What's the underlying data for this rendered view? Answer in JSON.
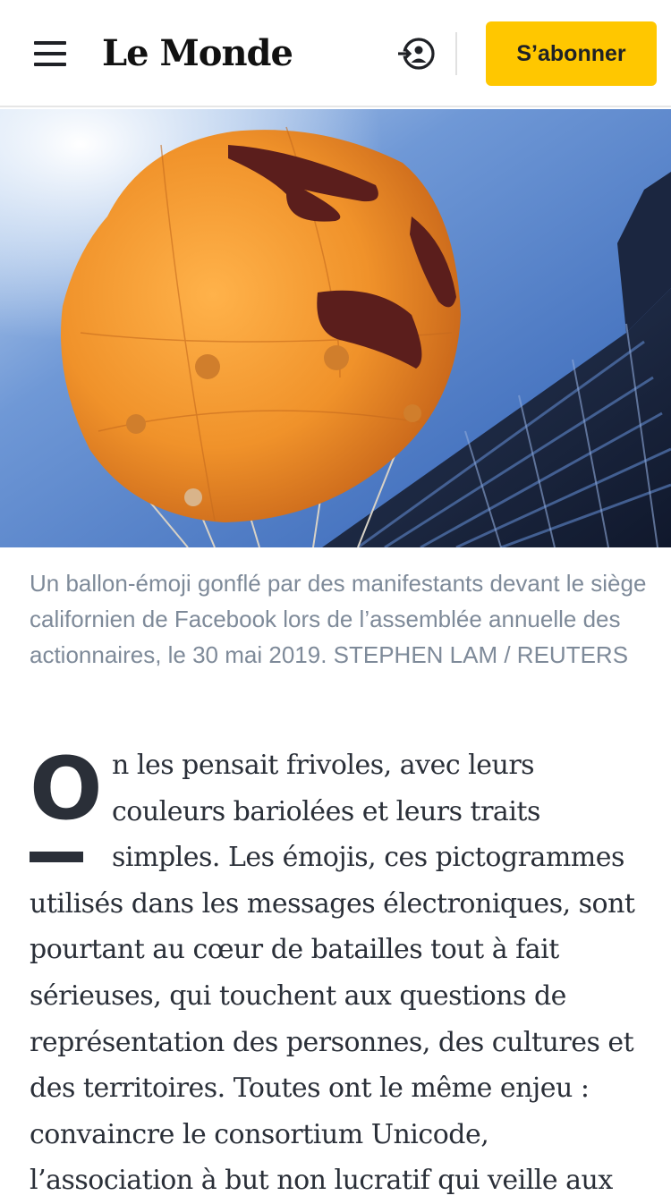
{
  "header": {
    "menu_icon": "hamburger-menu-icon",
    "logo_text": "Le Monde",
    "login_icon": "account-login-icon",
    "subscribe_label": "S’abonner",
    "subscribe_color": "#ffc700"
  },
  "photo": {
    "description_icon": "photo-balloon-emoji-building"
  },
  "caption": {
    "text": "Un ballon-émoji gonflé par des manifestants devant le siège californien de Facebook lors de l’assemblée annuelle des actionnaires, le 30 mai 2019. STEPHEN LAM / REUTERS"
  },
  "article": {
    "dropcap": "O",
    "body": "n les pensait frivoles, avec leurs couleurs bariolées et leurs traits simples. Les émojis, ces pictogrammes utilisés dans les messages électroniques, sont pourtant au cœur de batailles tout à fait sérieuses, qui touchent aux questions de représentation des personnes, des cultures et des territoires. Toutes ont le même enjeu : convaincre le consortium Unicode, l’association à but non lucratif qui veille aux"
  }
}
